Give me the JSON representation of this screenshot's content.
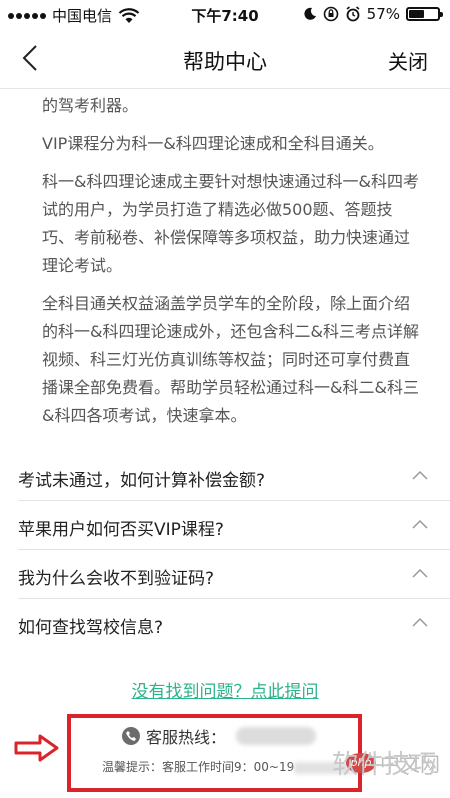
{
  "status_bar": {
    "carrier": "中国电信",
    "time": "下午7:40",
    "battery": "57%",
    "battery_level": 0.57
  },
  "nav": {
    "title": "帮助中心",
    "close_label": "关闭"
  },
  "article": {
    "paragraphs": [
      "的驾考利器。",
      "VIP课程分为科一&科四理论速成和全科目通关。",
      "科一&科四理论速成主要针对想快速通过科一&科四考试的用户，为学员打造了精选必做500题、答题技巧、考前秘卷、补偿保障等多项权益，助力快速通过理论考试。",
      "全科目通关权益涵盖学员学车的全阶段，除上面介绍的科一&科四理论速成外，还包含科二&科三考点详解视频、科三灯光仿真训练等权益；同时还可享付费直播课全部免费看。帮助学员轻松通过科一&科二&科三&科四各项考试，快速拿本。"
    ]
  },
  "faq": {
    "items": [
      "考试未通过，如何计算补偿金额?",
      "苹果用户如何否买VIP课程?",
      "我为什么会收不到验证码?",
      "如何查找驾校信息?"
    ]
  },
  "ask_link": "没有找到问题？点此提问",
  "hotline": {
    "label": "客服热线：",
    "tip": "温馨提示：客服工作时间9：00~19"
  },
  "watermark": {
    "php": "php",
    "site": "中文网",
    "text": "软件技巧"
  },
  "colors": {
    "link": "#2bb389",
    "highlight_box": "#d9242b"
  }
}
